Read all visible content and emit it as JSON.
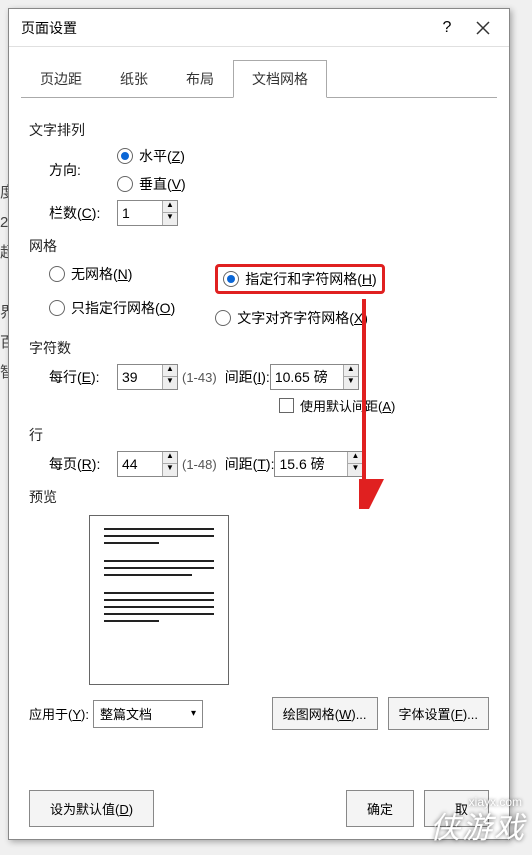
{
  "dialog": {
    "title": "页面设置",
    "help": "?",
    "tabs": [
      "页边距",
      "纸张",
      "布局",
      "文档网格"
    ],
    "activeTab": 3
  },
  "textDirection": {
    "title": "文字排列",
    "dirLabel": "方向:",
    "horizontal": "水平(Z)",
    "vertical": "垂直(V)",
    "colsLabel": "栏数(C):",
    "cols": "1"
  },
  "grid": {
    "title": "网格",
    "none": "无网格(N)",
    "lineOnly": "只指定行网格(O)",
    "lineChar": "指定行和字符网格(H)",
    "alignChar": "文字对齐字符网格(X)"
  },
  "chars": {
    "title": "字符数",
    "perLineLabel": "每行(E):",
    "perLine": "39",
    "perLineHint": "(1-43)",
    "spacingLabel": "间距(I):",
    "spacing": "10.65 磅",
    "defaultSpacing": "使用默认间距(A)"
  },
  "lines": {
    "title": "行",
    "perPageLabel": "每页(R):",
    "perPage": "44",
    "perPageHint": "(1-48)",
    "spacingLabel": "间距(T):",
    "spacing": "15.6 磅"
  },
  "preview": {
    "title": "预览"
  },
  "apply": {
    "label": "应用于(Y):",
    "value": "整篇文档",
    "drawGrid": "绘图网格(W)...",
    "fontSettings": "字体设置(F)..."
  },
  "footer": {
    "setDefault": "设为默认值(D)",
    "ok": "确定",
    "cancel": "取"
  },
  "watermark": {
    "url": "xiayx.com",
    "brand": "侠游戏"
  }
}
